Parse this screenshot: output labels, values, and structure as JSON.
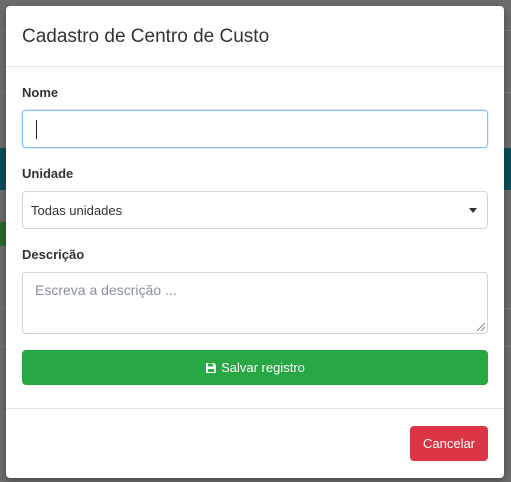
{
  "modal": {
    "title": "Cadastro de Centro de Custo"
  },
  "form": {
    "nome_label": "Nome",
    "nome_value": "",
    "unidade_label": "Unidade",
    "unidade_selected": "Todas unidades",
    "descricao_label": "Descrição",
    "descricao_placeholder": "Escreva a descrição ...",
    "save_label": "Salvar registro",
    "save_icon": "floppy-disk-icon"
  },
  "footer": {
    "cancel_label": "Cancelar"
  },
  "colors": {
    "save": "#28a745",
    "cancel": "#dc3545",
    "focus_border": "#80bdff",
    "header_bar": "#0d4f5c"
  }
}
